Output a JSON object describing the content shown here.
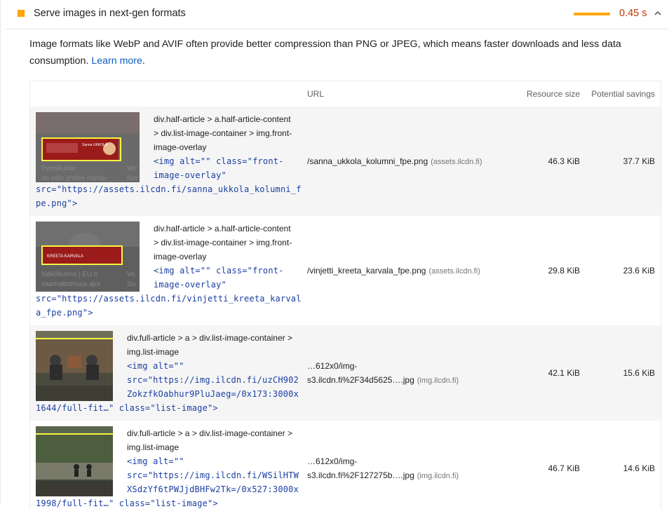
{
  "audit": {
    "title": "Serve images in next-gen formats",
    "savings": "0.45 s",
    "savings_fraction": 0.55,
    "description": "Image formats like WebP and AVIF often provide better compression than PNG or JPEG, which means faster downloads and less data consumption.",
    "learn_more": "Learn more",
    "period": "."
  },
  "colors": {
    "severity": "#ffa400",
    "savings_text": "#c33300",
    "link": "#0d5fbf",
    "code": "#1a3fa3"
  },
  "icons": {
    "severity": "orange-square-icon",
    "collapse": "chevron-up-icon"
  },
  "table": {
    "headers": {
      "url": "URL",
      "size": "Resource size",
      "savings": "Potential savings"
    },
    "rows": [
      {
        "thumb_caption_a": "Ihmiskunta",
        "thumb_caption_b": "on vain yhden harha-",
        "thumb_caption_c": "Ver",
        "thumb_caption_d": "Nor",
        "thumb_banner": "Sanna UKKOLA",
        "node_path_1": "div.half-article > a.half-article-content",
        "node_path_2": "> div.list-image-container > img.front-",
        "node_path_3": "image-overlay",
        "snippet_1": "<img alt=\"\" class=\"front-",
        "snippet_2": "image-overlay\"",
        "snippet_3": "src=\"https://assets.ilcdn.fi/sanna_ukkola_kolumni_f",
        "snippet_4": "pe.png\">",
        "url": "/sanna_ukkola_kolumni_fpe.png",
        "origin": "(assets.ilcdn.fi)",
        "size": "46.3 KiB",
        "savings": "37.7 KiB"
      },
      {
        "thumb_caption_a": "Näkökulma | EU:n",
        "thumb_caption_b": "saamattomuus ajoi",
        "thumb_caption_c": "Vo",
        "thumb_caption_d": "Su",
        "thumb_banner": "KREETA KARVALA",
        "node_path_1": "div.half-article > a.half-article-content",
        "node_path_2": "> div.list-image-container > img.front-",
        "node_path_3": "image-overlay",
        "snippet_1": "<img alt=\"\" class=\"front-",
        "snippet_2": "image-overlay\"",
        "snippet_3": "src=\"https://assets.ilcdn.fi/vinjetti_kreeta_karval",
        "snippet_4": "a_fpe.png\">",
        "url": "/vinjetti_kreeta_karvala_fpe.png",
        "origin": "(assets.ilcdn.fi)",
        "size": "29.8 KiB",
        "savings": "23.6 KiB"
      },
      {
        "node_path_1": "div.full-article > a > div.list-image-container >",
        "node_path_2": "img.list-image",
        "snippet_1": "<img alt=\"\"",
        "snippet_2": "src=\"https://img.ilcdn.fi/uzCH902",
        "snippet_3": "ZokzfkOabhur9PluJaeg=/0x173:3000x",
        "snippet_4": "1644/full-fit…\" class=\"list-image\">",
        "url_1": "…612x0/img-",
        "url_2": "s3.ilcdn.fi%2F34d5625….jpg",
        "origin": "(img.ilcdn.fi)",
        "size": "42.1 KiB",
        "savings": "15.6 KiB"
      },
      {
        "node_path_1": "div.full-article > a > div.list-image-container >",
        "node_path_2": "img.list-image",
        "snippet_1": "<img alt=\"\"",
        "snippet_2": "src=\"https://img.ilcdn.fi/WSilHTW",
        "snippet_3": "XSdzYf6tPWJjdBHFw2Tk=/0x527:3000x",
        "snippet_4": "1998/full-fit…\" class=\"list-image\">",
        "url_1": "…612x0/img-",
        "url_2": "s3.ilcdn.fi%2F127275b….jpg",
        "origin": "(img.ilcdn.fi)",
        "size": "46.7 KiB",
        "savings": "14.6 KiB"
      }
    ]
  }
}
